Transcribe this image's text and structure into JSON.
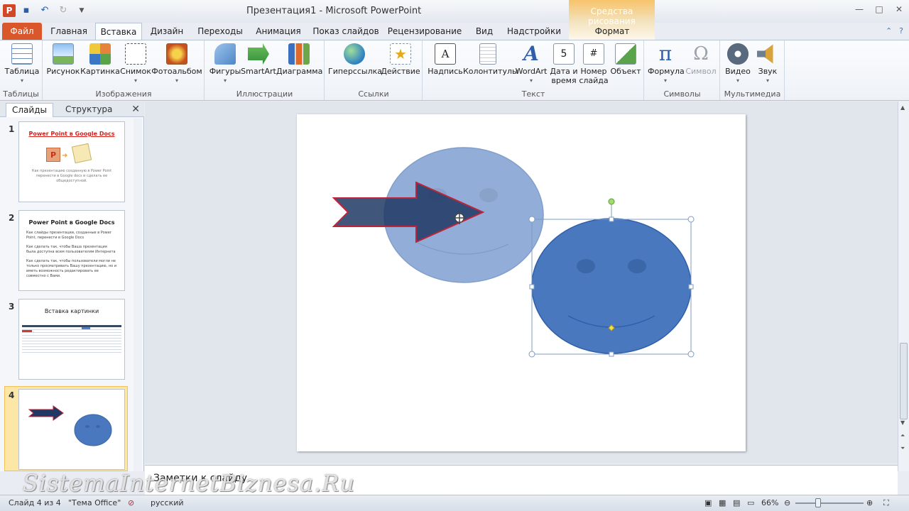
{
  "window": {
    "title": "Презентация1 - Microsoft PowerPoint",
    "contextual_tools": "Средства рисования"
  },
  "tabs": [
    "Файл",
    "Главная",
    "Вставка",
    "Дизайн",
    "Переходы",
    "Анимация",
    "Показ слайдов",
    "Рецензирование",
    "Вид",
    "Надстройки",
    "Формат"
  ],
  "ribbon": {
    "groups": {
      "tables": "Таблицы",
      "images": "Изображения",
      "illustrations": "Иллюстрации",
      "links": "Ссылки",
      "text": "Текст",
      "symbols": "Символы",
      "multimedia": "Мультимедиа"
    },
    "buttons": {
      "table": "Таблица",
      "picture": "Рисунок",
      "clipart": "Картинка",
      "screenshot": "Снимок",
      "album": "Фотоальбом",
      "shapes": "Фигуры",
      "smartart": "SmartArt",
      "chart": "Диаграмма",
      "hyperlink": "Гиперссылка",
      "action": "Действие",
      "textbox": "Надпись",
      "header_footer": "Колонтитулы",
      "wordart": "WordArt",
      "datetime_1": "Дата и",
      "datetime_2": "время",
      "slidenum_1": "Номер",
      "slidenum_2": "слайда",
      "object": "Объект",
      "equation": "Формула",
      "symbol": "Символ",
      "video": "Видео",
      "audio": "Звук"
    }
  },
  "panel": {
    "tab_slides": "Слайды",
    "tab_outline": "Структура",
    "slides": [
      {
        "num": "1",
        "title": "Power Point в Google Docs",
        "body": "Как презентацию созданную в Power Point перенести в Google docs и сделать ее общедоступной."
      },
      {
        "num": "2",
        "title": "Power Point в Google Docs",
        "bullets": [
          "Как слайды презентации, созданные в Power Point, перенести в Google Docs",
          "Как сделать так, чтобы Ваша презентация была доступна всем пользователям Интернета",
          "Как сделать так, чтобы пользователи могли не только просматривать Вашу презентацию, но и иметь возможность редактировать ее совместно с Вами."
        ]
      },
      {
        "num": "3",
        "title": "Вставка картинки"
      },
      {
        "num": "4"
      }
    ]
  },
  "notes": {
    "placeholder": "Заметки к слайду"
  },
  "status": {
    "slide": "Слайд 4 из 4",
    "theme": "\"Тема Office\"",
    "language": "русский",
    "zoom": "66%"
  },
  "watermark": "SistemaInternetBiznesa.Ru",
  "colors": {
    "accent_file_tab": "#d9572b",
    "smiley_fill": "#4a78bf",
    "arrow_fill": "#1f3864",
    "arrow_outline": "#c0243a"
  }
}
